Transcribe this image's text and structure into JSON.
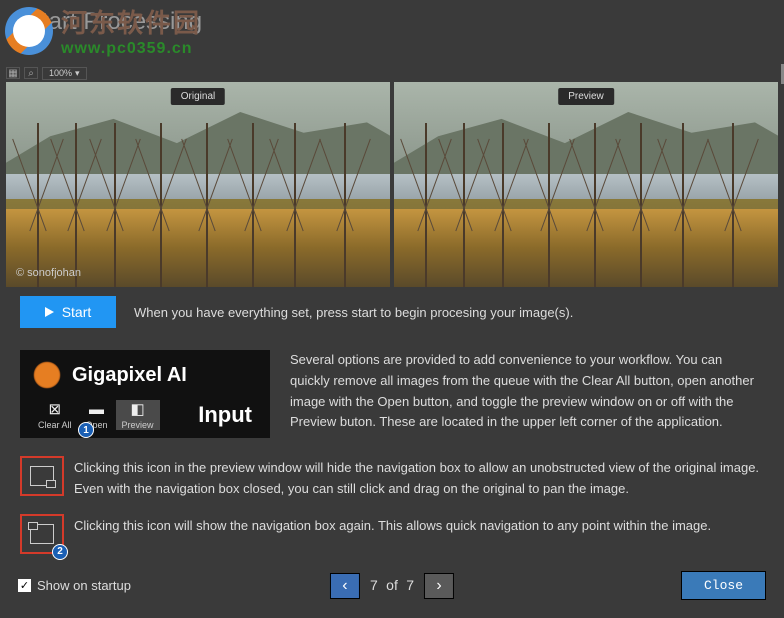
{
  "watermark": {
    "cn": "河东软件园",
    "url": "www.pc0359.cn"
  },
  "title": "Start Processing",
  "toolbar": {
    "zoom": "100%"
  },
  "preview": {
    "original_label": "Original",
    "preview_label": "Preview",
    "credit": "© sonofjohan"
  },
  "start": {
    "label": "Start",
    "desc": "When you have everything set, press start to begin procesing your image(s)."
  },
  "input": {
    "brand": "Gigapixel AI",
    "title": "Input",
    "buttons": {
      "clear": "Clear All",
      "open": "Open",
      "preview": "Preview"
    },
    "desc": "Several options are provided to add convenience to your workflow. You can quickly remove all images from the queue with the Clear All button, open another image with the Open button, and toggle the preview window on or off with the Preview buton. These are located in the upper left corner of the application."
  },
  "hide_nav": {
    "desc": "Clicking this icon in the preview window will hide the navigation box to allow an unobstructed view of the original image. Even with the navigation box closed, you can still click and drag on the original to pan the image."
  },
  "show_nav": {
    "desc": "Clicking this icon will show the navigation box again. This allows quick navigation to any point within the image."
  },
  "callouts": {
    "one": "1",
    "two": "2"
  },
  "footer": {
    "startup": "Show on startup",
    "page_current": "7",
    "page_sep": "of",
    "page_total": "7",
    "close": "Close"
  }
}
